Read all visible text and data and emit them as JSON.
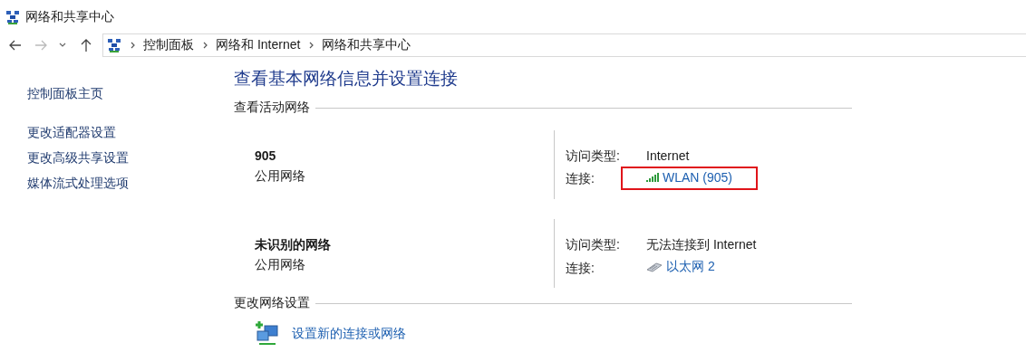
{
  "window": {
    "title": "网络和共享中心"
  },
  "breadcrumb": [
    "控制面板",
    "网络和 Internet",
    "网络和共享中心"
  ],
  "sidebar": {
    "items": [
      "控制面板主页",
      "更改适配器设置",
      "更改高级共享设置",
      "媒体流式处理选项"
    ]
  },
  "heading": "查看基本网络信息并设置连接",
  "active_networks": {
    "title": "查看活动网络",
    "networks": [
      {
        "name": "905",
        "category": "公用网络",
        "access_label": "访问类型:",
        "access": "Internet",
        "connection_label": "连接:",
        "connection": "WLAN (905)",
        "kind": "wifi",
        "highlighted": true
      },
      {
        "name": "未识别的网络",
        "category": "公用网络",
        "access_label": "访问类型:",
        "access": "无法连接到 Internet",
        "connection_label": "连接:",
        "connection": "以太网 2",
        "kind": "ethernet",
        "highlighted": false
      }
    ]
  },
  "change_settings": {
    "title": "更改网络设置",
    "items": [
      {
        "label": "设置新的连接或网络"
      }
    ]
  }
}
